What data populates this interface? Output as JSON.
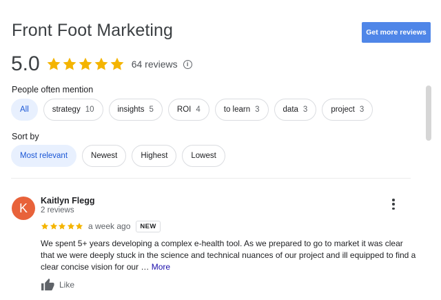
{
  "header": {
    "title": "Front Foot Marketing",
    "get_reviews_button": "Get more reviews"
  },
  "rating": {
    "score": "5.0",
    "stars": 5,
    "review_count": "64 reviews",
    "info_icon": "info-icon",
    "star_color": "#f4b400"
  },
  "mentions": {
    "label": "People often mention",
    "chips": [
      {
        "label": "All",
        "count": "",
        "selected": true
      },
      {
        "label": "strategy",
        "count": "10"
      },
      {
        "label": "insights",
        "count": "5"
      },
      {
        "label": "ROI",
        "count": "4"
      },
      {
        "label": "to learn",
        "count": "3"
      },
      {
        "label": "data",
        "count": "3"
      },
      {
        "label": "project",
        "count": "3"
      }
    ]
  },
  "sort": {
    "label": "Sort by",
    "options": [
      {
        "label": "Most relevant",
        "selected": true
      },
      {
        "label": "Newest"
      },
      {
        "label": "Highest"
      },
      {
        "label": "Lowest"
      }
    ]
  },
  "review": {
    "avatar_letter": "K",
    "avatar_color": "#e8623a",
    "name": "Kaitlyn Flegg",
    "meta": "2 reviews",
    "stars": 5,
    "date": "a week ago",
    "badge": "NEW",
    "text": "We spent 5+ years developing a complex e-health tool. As we prepared to go to market it was clear that we were deeply stuck in the science and technical nuances of our project and ill equipped to find a clear concise vision for our … ",
    "more_link": "More",
    "like_label": "Like"
  },
  "colors": {
    "accent": "#4f86e8",
    "chip_selected_bg": "#e8f0fe",
    "chip_selected_text": "#1a56d6"
  }
}
